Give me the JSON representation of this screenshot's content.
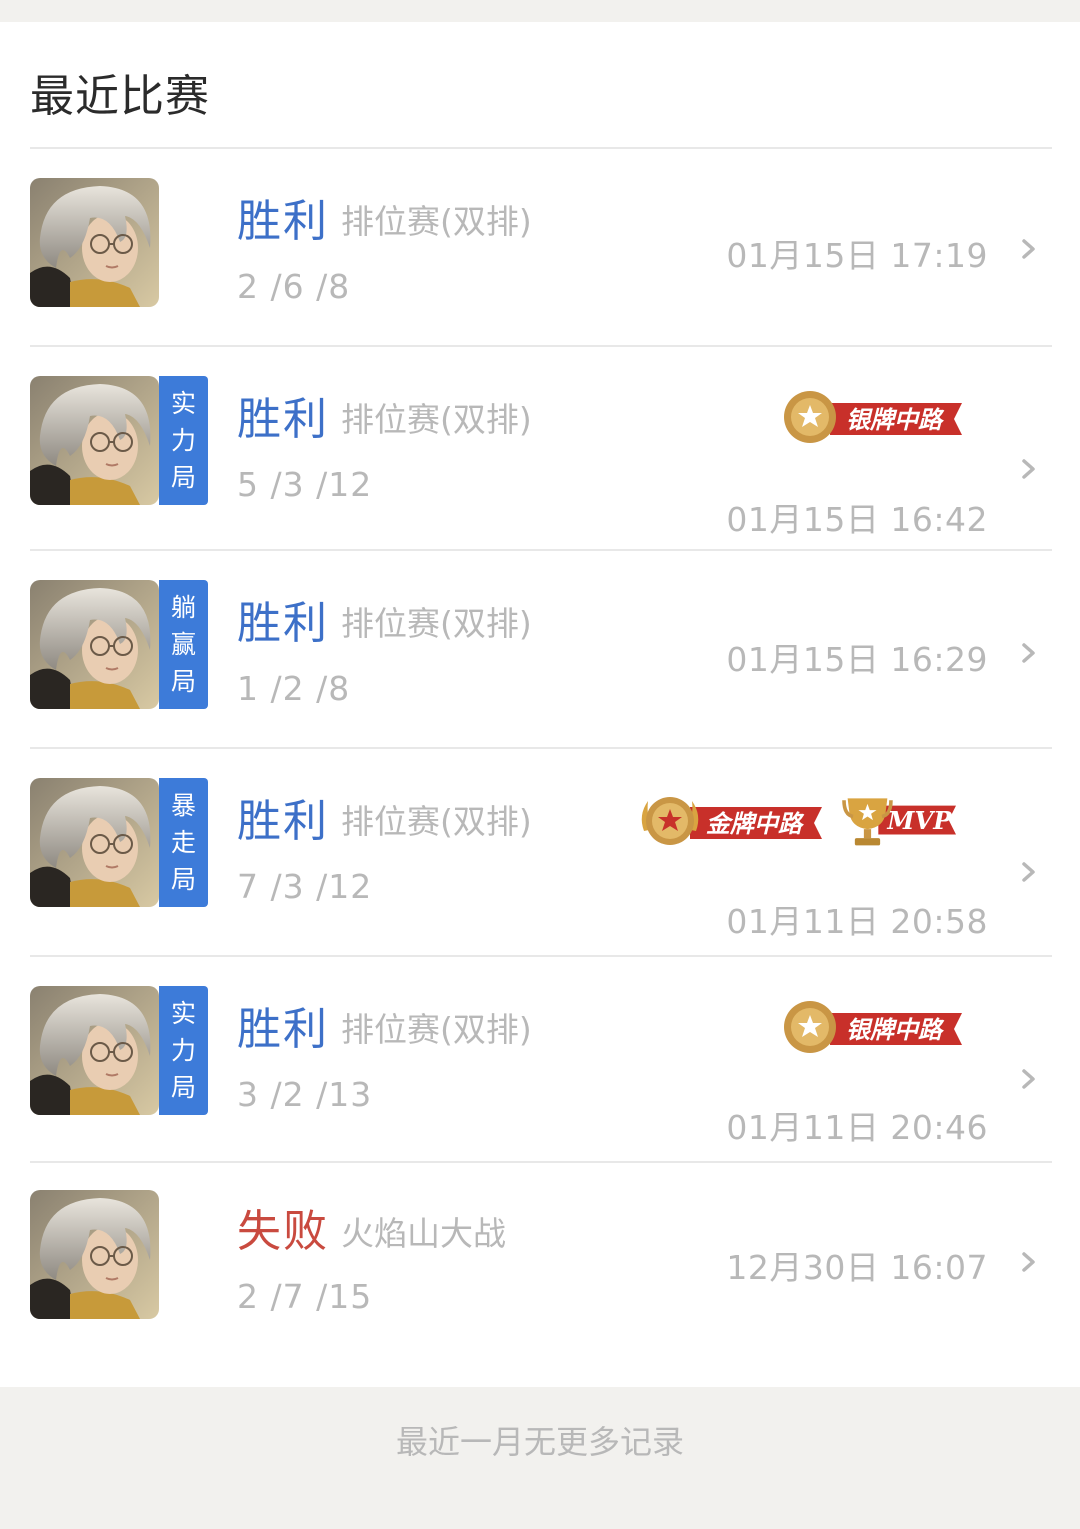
{
  "section": {
    "title": "最近比赛"
  },
  "matches": [
    {
      "result": "胜利",
      "mode": "排位赛(双排)",
      "kda": "2 /6 /8",
      "time": "01月15日 17:19",
      "tag": "",
      "badges": []
    },
    {
      "result": "胜利",
      "mode": "排位赛(双排)",
      "kda": "5 /3 /12",
      "time": "01月15日 16:42",
      "tag": "实力局",
      "badges": [
        "银牌中路"
      ]
    },
    {
      "result": "胜利",
      "mode": "排位赛(双排)",
      "kda": "1 /2 /8",
      "time": "01月15日 16:29",
      "tag": "躺赢局",
      "badges": []
    },
    {
      "result": "胜利",
      "mode": "排位赛(双排)",
      "kda": "7 /3 /12",
      "time": "01月11日 20:58",
      "tag": "暴走局",
      "badges": [
        "金牌中路",
        "MVP"
      ]
    },
    {
      "result": "胜利",
      "mode": "排位赛(双排)",
      "kda": "3 /2 /13",
      "time": "01月11日 20:46",
      "tag": "实力局",
      "badges": [
        "银牌中路"
      ]
    },
    {
      "result": "失败",
      "mode": "火焰山大战",
      "kda": "2 /7 /15",
      "time": "12月30日 16:07",
      "tag": "",
      "badges": []
    }
  ],
  "footer": {
    "text": "最近一月无更多记录"
  },
  "colors": {
    "win": "#3d70c8",
    "lose": "#c94a3f",
    "tag": "#3d7bd9",
    "muted": "#b8b8b8",
    "badge_red": "#c8302a",
    "badge_gold": "#d9a441"
  },
  "icons": {
    "avatar": "hero-portrait-icon",
    "chevron": "chevron-right-icon",
    "medal": "medal-icon",
    "trophy": "trophy-icon"
  }
}
